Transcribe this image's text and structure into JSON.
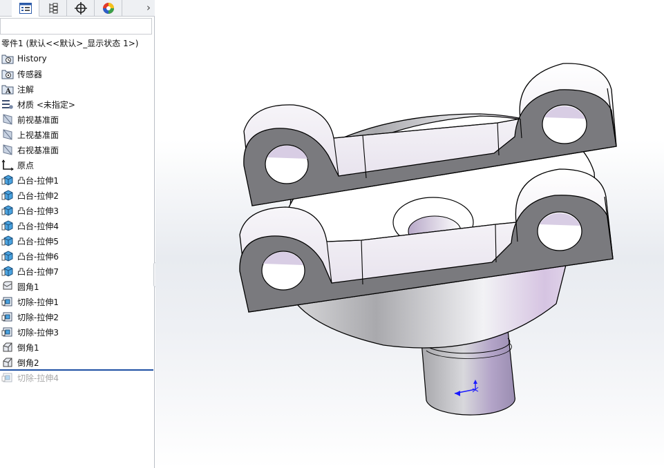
{
  "feature_manager": {
    "tabs": [
      {
        "name": "feature-tree-tab",
        "icon": "feature-tree-icon"
      },
      {
        "name": "property-manager-tab",
        "icon": "property-manager-icon"
      },
      {
        "name": "configuration-manager-tab",
        "icon": "configuration-manager-icon"
      },
      {
        "name": "dimxpert-tab",
        "icon": "crosshair-icon"
      },
      {
        "name": "display-manager-tab",
        "icon": "appearance-sphere-icon"
      }
    ],
    "more_tabs_glyph": "›",
    "filter_placeholder": "",
    "root_label": "零件1  (默认<<默认>_显示状态 1>)",
    "items": [
      {
        "label": "History",
        "icon": "history-folder-icon",
        "enabled": true
      },
      {
        "label": "传感器",
        "icon": "sensor-folder-icon",
        "enabled": true
      },
      {
        "label": "注解",
        "icon": "annotation-folder-icon",
        "enabled": true
      },
      {
        "label": "材质 <未指定>",
        "icon": "material-icon",
        "enabled": true
      },
      {
        "label": "前视基准面",
        "icon": "plane-icon",
        "enabled": true
      },
      {
        "label": "上视基准面",
        "icon": "plane-icon",
        "enabled": true
      },
      {
        "label": "右视基准面",
        "icon": "plane-icon",
        "enabled": true
      },
      {
        "label": "原点",
        "icon": "origin-icon",
        "enabled": true
      },
      {
        "label": "凸台-拉伸1",
        "icon": "boss-extrude-icon",
        "enabled": true
      },
      {
        "label": "凸台-拉伸2",
        "icon": "boss-extrude-icon",
        "enabled": true
      },
      {
        "label": "凸台-拉伸3",
        "icon": "boss-extrude-icon",
        "enabled": true
      },
      {
        "label": "凸台-拉伸4",
        "icon": "boss-extrude-icon",
        "enabled": true
      },
      {
        "label": "凸台-拉伸5",
        "icon": "boss-extrude-icon",
        "enabled": true
      },
      {
        "label": "凸台-拉伸6",
        "icon": "boss-extrude-icon",
        "enabled": true
      },
      {
        "label": "凸台-拉伸7",
        "icon": "boss-extrude-icon",
        "enabled": true
      },
      {
        "label": "圆角1",
        "icon": "fillet-icon",
        "enabled": true
      },
      {
        "label": "切除-拉伸1",
        "icon": "cut-extrude-icon",
        "enabled": true
      },
      {
        "label": "切除-拉伸2",
        "icon": "cut-extrude-icon",
        "enabled": true
      },
      {
        "label": "切除-拉伸3",
        "icon": "cut-extrude-icon",
        "enabled": true
      },
      {
        "label": "倒角1",
        "icon": "chamfer-icon",
        "enabled": true
      },
      {
        "label": "倒角2",
        "icon": "chamfer-icon",
        "enabled": true
      },
      {
        "label": "切除-拉伸4",
        "icon": "cut-extrude-icon",
        "enabled": false
      }
    ]
  },
  "colors": {
    "accent": "#1d4fa3",
    "part_dark_face": "#7b7b7f",
    "part_light_face": "#f7f7fa",
    "part_tint": "#d9c7e6",
    "triad": "#1a1aff"
  }
}
